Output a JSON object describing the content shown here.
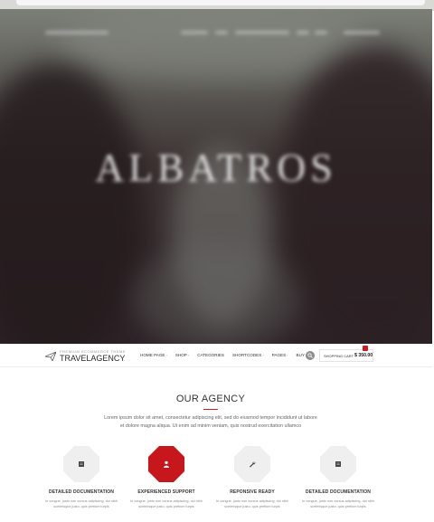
{
  "hero": {
    "subtitle": "",
    "title": "ALBATROS",
    "tagline": ""
  },
  "logo": {
    "sub_text": "PREMIUM ECOMMERCE THEME",
    "main_text": "TRAVELAGENCY"
  },
  "nav": {
    "items": [
      {
        "label": "HOME PAGE",
        "has_dropdown": true
      },
      {
        "label": "SHOP",
        "has_dropdown": true
      },
      {
        "label": "CATEGORIES",
        "has_dropdown": false
      },
      {
        "label": "SHORTCODES",
        "has_dropdown": true
      },
      {
        "label": "PAGES",
        "has_dropdown": true
      },
      {
        "label": "BUY",
        "has_dropdown": false
      }
    ],
    "search_icon": "search-icon",
    "cart_label": "SHOPPING CART",
    "cart_price": "$ 350.00",
    "accent_color": "#d0191e"
  },
  "agency": {
    "title": "OUR AGENCY",
    "intro": "Lorem ipsum dolor sit amet, consectetur adipiscing elit, sed do eiusmod tempor incididunt ut labore et dolore magna aliqua. Ut enim ad minim veniam, quis nostrud exercitation ullamco",
    "features": [
      {
        "icon": "book-icon",
        "title": "DETAILED DOCUMENTATION",
        "text": "In congue, justo non cursus adipiscing, dui nibh scelerisque justo, quis pretium turpis",
        "active": false
      },
      {
        "icon": "support-icon",
        "title": "EXPERIENCED SUPPORT",
        "text": "In congue, justo non cursus adipiscing, dui nibh scelerisque justo, quis pretium turpis",
        "active": true
      },
      {
        "icon": "wrench-icon",
        "title": "REPONSIVE READY",
        "text": "In congue, justo non cursus adipiscing, dui nibh scelerisque justo, quis pretium turpis",
        "active": false
      },
      {
        "icon": "book-icon",
        "title": "DETAILED DOCUMENTATION",
        "text": "In congue, justo non cursus adipiscing, dui nibh scelerisque justo, quis pretium turpis",
        "active": false
      }
    ]
  }
}
